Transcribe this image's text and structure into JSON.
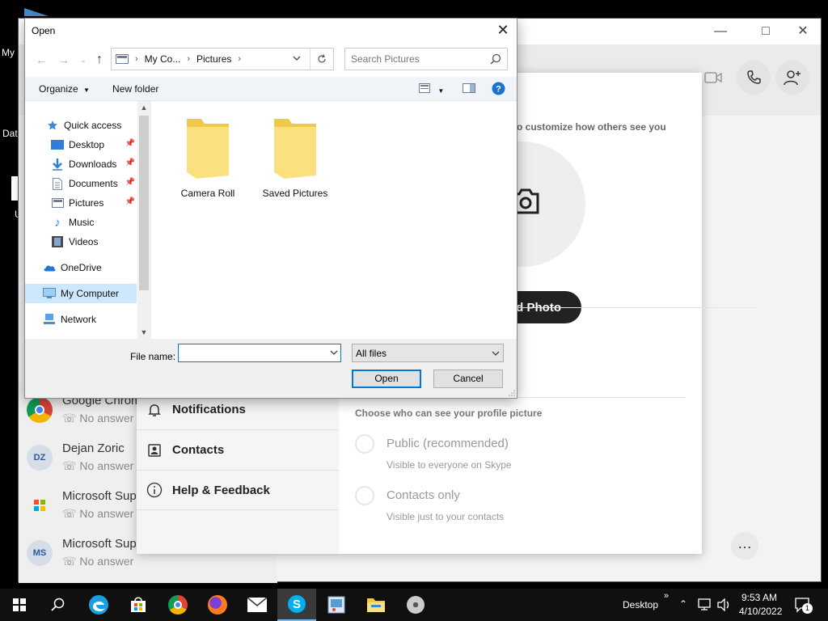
{
  "desktop": {
    "icon_labels": [
      "My",
      "Dat",
      "U"
    ]
  },
  "skype": {
    "modal": {
      "customize_text": "o customize how others see you",
      "upload_button": "d Photo",
      "sidebar": [
        {
          "label": "Notifications",
          "icon": "bell-icon"
        },
        {
          "label": "Contacts",
          "icon": "contacts-icon"
        },
        {
          "label": "Help & Feedback",
          "icon": "info-icon"
        }
      ],
      "privacy_title": "Choose who can see your profile picture",
      "options": [
        {
          "label": "Public (recommended)",
          "sub": "Visible to everyone on Skype"
        },
        {
          "label": "Contacts only",
          "sub": "Visible just to your contacts"
        }
      ]
    },
    "chats": [
      {
        "name": "Google Chrom",
        "status": "No answer",
        "avatar": "chrome-logo"
      },
      {
        "name": "Dejan Zoric",
        "status": "No answer",
        "avatar": "DZ"
      },
      {
        "name": "Microsoft Sup",
        "status": "No answer",
        "avatar": "microsoft-logo"
      },
      {
        "name": "Microsoft Sup",
        "status": "No answer",
        "avatar": "MS"
      }
    ]
  },
  "dialog": {
    "title": "Open",
    "address": {
      "crumbs": [
        "My Co...",
        "Pictures"
      ]
    },
    "search_placeholder": "Search Pictures",
    "toolbar": {
      "organize": "Organize",
      "new_folder": "New folder"
    },
    "nav": {
      "quick_access": "Quick access",
      "desktop": "Desktop",
      "downloads": "Downloads",
      "documents": "Documents",
      "pictures": "Pictures",
      "music": "Music",
      "videos": "Videos",
      "onedrive": "OneDrive",
      "my_computer": "My Computer",
      "network": "Network"
    },
    "folders": [
      "Camera Roll",
      "Saved Pictures"
    ],
    "file_name_label": "File name:",
    "file_name_value": "",
    "file_type": "All files",
    "open_button": "Open",
    "cancel_button": "Cancel"
  },
  "taskbar": {
    "apps": [
      "start",
      "search",
      "edge",
      "store",
      "chrome",
      "firefox",
      "mail",
      "skype",
      "paint",
      "file-explorer",
      "media"
    ],
    "desktop_label": "Desktop",
    "time": "9:53 AM",
    "date": "4/10/2022",
    "notification_count": "1"
  }
}
